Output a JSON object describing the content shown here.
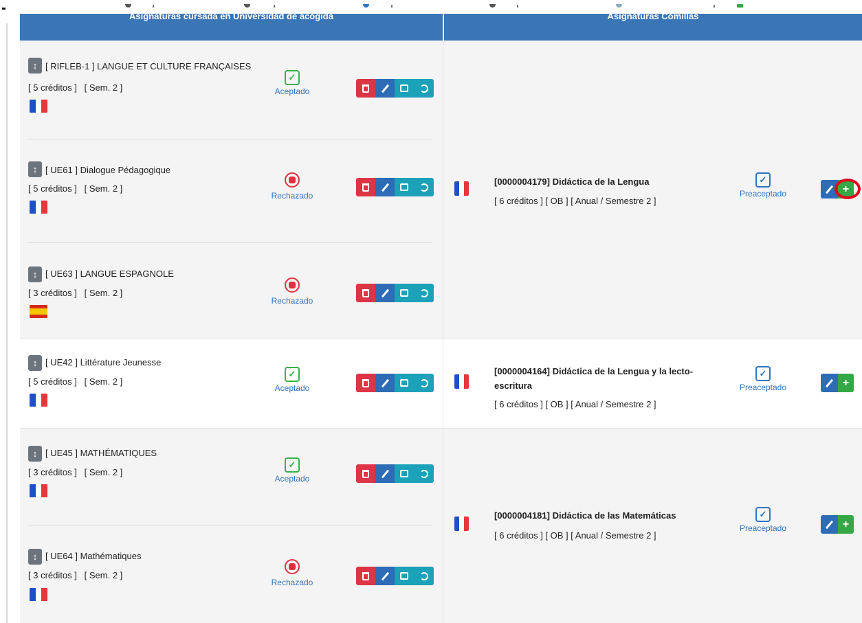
{
  "header": {
    "left": "Asignaturas cursada en Universidad de acogida",
    "right": "Asignaturas Comillas"
  },
  "host_courses": [
    {
      "code_title": "[ RIFLEB-1 ] LANGUE ET CULTURE FRANÇAISES",
      "credits": "[ 5 créditos ]",
      "semester": "[ Sem. 2 ]",
      "flag": "fr",
      "status": "Aceptado"
    },
    {
      "code_title": "[ UE61 ] Dialogue Pédagogique",
      "credits": "[ 5 créditos ]",
      "semester": "[ Sem. 2 ]",
      "flag": "fr",
      "status": "Rechazado"
    },
    {
      "code_title": "[ UE63 ] LANGUE ESPAGNOLE",
      "credits": "[ 3 créditos ]",
      "semester": "[ Sem. 2 ]",
      "flag": "es",
      "status": "Rechazado"
    },
    {
      "code_title": "[ UE42 ] Littérature Jeunesse",
      "credits": "[ 5 créditos ]",
      "semester": "[ Sem. 2 ]",
      "flag": "fr",
      "status": "Aceptado"
    },
    {
      "code_title": "[ UE45 ] MATHÉMATIQUES",
      "credits": "[ 3 créditos ]",
      "semester": "[ Sem. 2 ]",
      "flag": "fr",
      "status": "Aceptado"
    },
    {
      "code_title": "[ UE64 ] Mathématiques",
      "credits": "[ 3 créditos ]",
      "semester": "[ Sem. 2 ]",
      "flag": "fr",
      "status": "Rechazado"
    }
  ],
  "comillas_courses": [
    {
      "title": "[0000004179] Didáctica de la Lengua",
      "meta": "[ 6 créditos ] [ OB ] [ Anual / Semestre 2 ]",
      "status": "Preaceptado"
    },
    {
      "title_line1": "[0000004164] Didáctica de la Lengua y la lecto-",
      "title_line2": "escritura",
      "meta": "[ 6 créditos ] [ OB ] [ Anual / Semestre 2 ]",
      "status": "Preaceptado"
    },
    {
      "title": "[0000004181] Didáctica de las Matemáticas",
      "meta": "[ 6 créditos ] [ OB ] [ Anual / Semestre 2 ]",
      "status": "Preaceptado"
    }
  ],
  "icons": {
    "sort": "sort-arrows-icon",
    "accepted": "check-square-icon",
    "rejected": "x-circle-icon",
    "preaccepted": "check-square-icon",
    "delete": "trash-icon",
    "edit": "pencil-icon",
    "comment": "speech-bubble-icon",
    "history": "history-icon",
    "add": "plus-icon"
  },
  "glyphs": {
    "sort": "↕",
    "check": "✓",
    "plus": "+"
  },
  "colors": {
    "header": "#3a76b6",
    "accepted": "#36b24a",
    "rejected": "#e0303f",
    "link": "#2f74c0",
    "delete": "#dc3545",
    "edit": "#2e6cb5",
    "info": "#1ba2b8",
    "add": "#36a745",
    "highlight_ring": "#e3051d"
  }
}
